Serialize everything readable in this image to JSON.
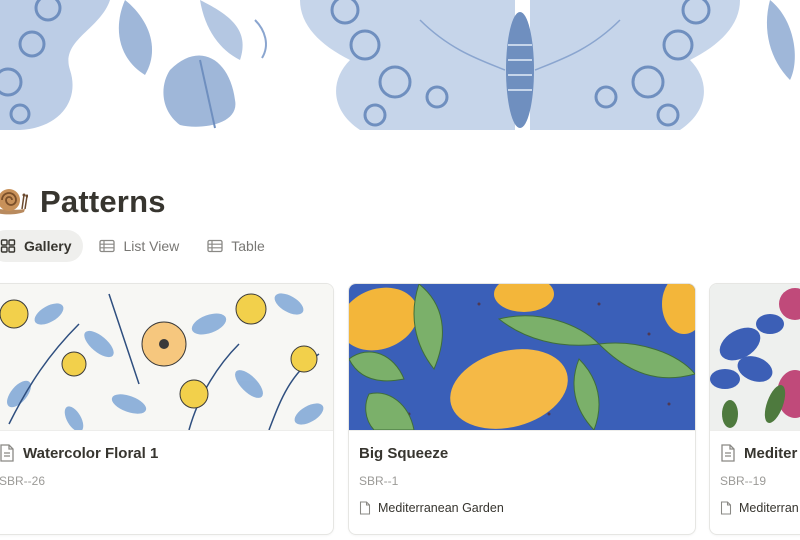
{
  "page": {
    "title": "Patterns",
    "emoji_icon": "snail-emoji"
  },
  "views": [
    {
      "label": "Gallery",
      "icon": "gallery-grid-icon",
      "active": true
    },
    {
      "label": "List View",
      "icon": "list-view-icon",
      "active": false
    },
    {
      "label": "Table",
      "icon": "table-icon",
      "active": false
    }
  ],
  "cards": [
    {
      "title": "Watercolor Floral 1",
      "id": "SBR--26",
      "collection": ""
    },
    {
      "title": "Big Squeeze",
      "id": "SBR--1",
      "collection": "Mediterranean Garden"
    },
    {
      "title": "Mediter",
      "id": "SBR--19",
      "collection": "Mediterran"
    }
  ],
  "colors": {
    "cover_bg": "#dde6f3",
    "butterfly": "#a9bfdc",
    "active_tab_bg": "#efefed",
    "text": "#37352f",
    "muted": "#9b9a97"
  }
}
